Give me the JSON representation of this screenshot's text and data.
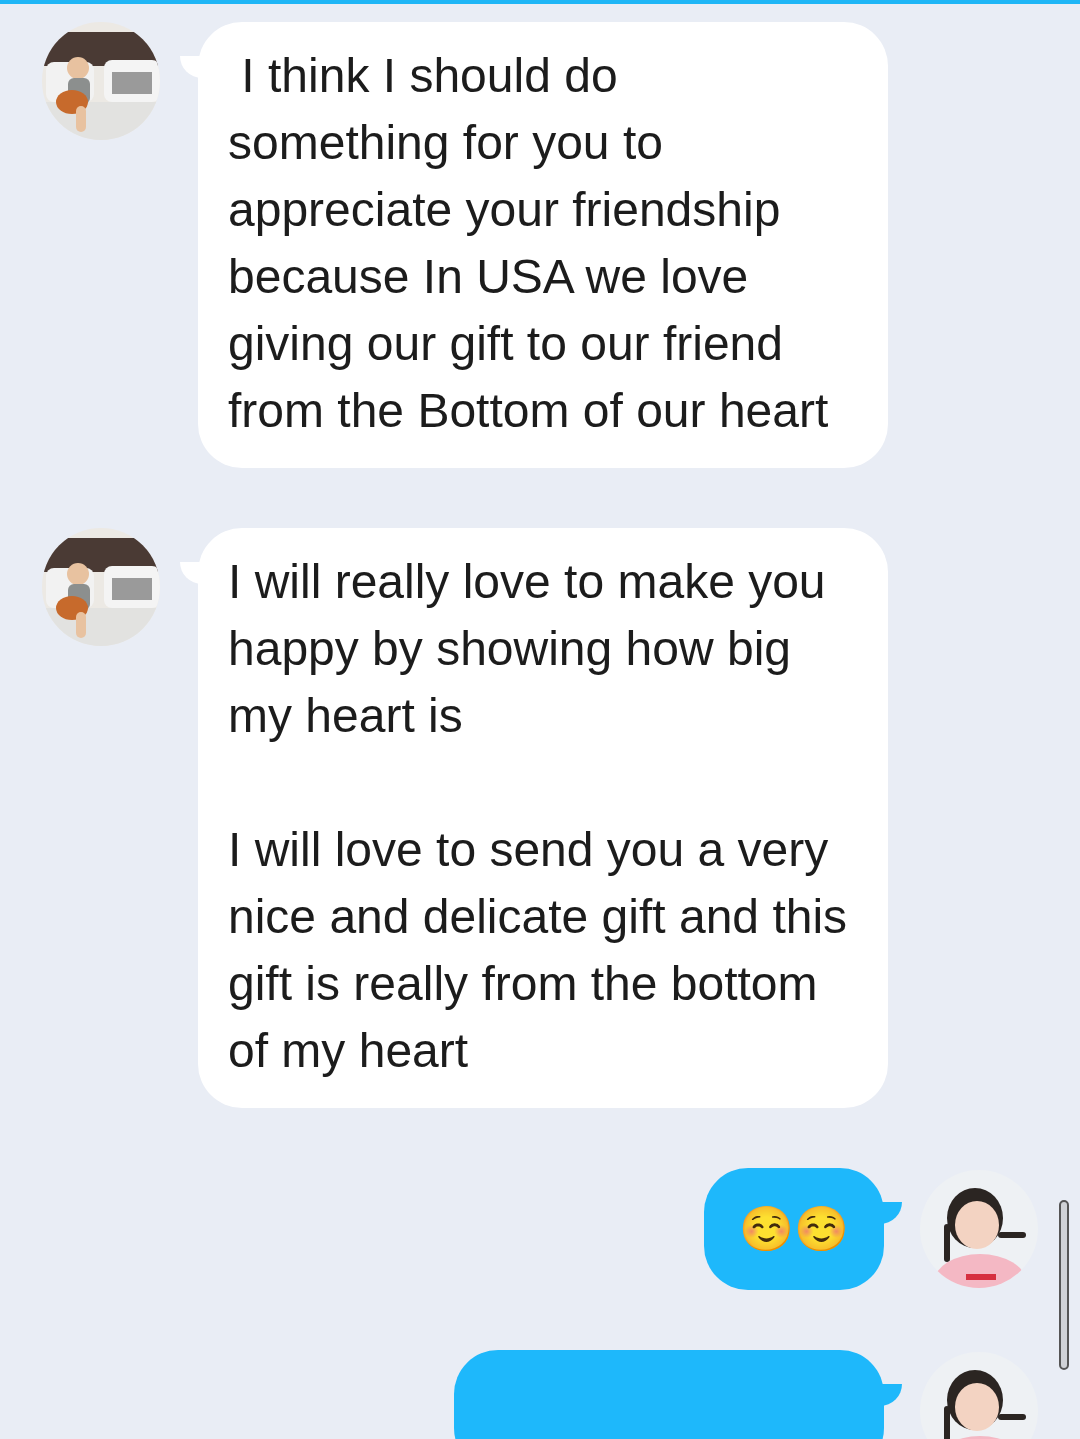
{
  "messages": [
    {
      "kind": "incoming",
      "text": " I think I should do something for you to appreciate your friendship because In USA we love giving our gift to our friend from the Bottom of our heart"
    },
    {
      "kind": "incoming",
      "text": "I will really love to make you happy by showing how big my heart is\n\nI will love to send you a very nice and delicate gift and this gift is really from the bottom of my heart"
    },
    {
      "kind": "outgoing",
      "text": "☺️☺️"
    },
    {
      "kind": "outgoing"
    }
  ]
}
